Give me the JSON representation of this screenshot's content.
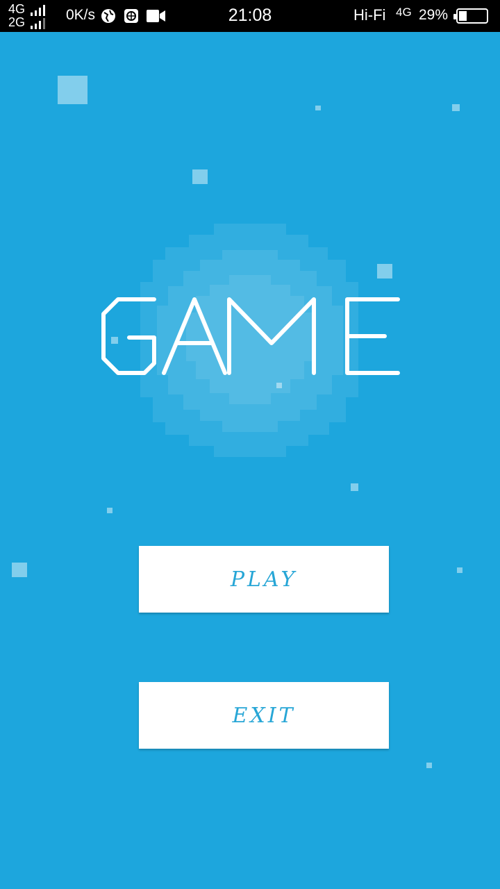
{
  "status_bar": {
    "network_top": "4G",
    "network_bottom": "2G",
    "speed": "0K/s",
    "time": "21:08",
    "hifi": "Hi-Fi",
    "data_type": "4G",
    "battery": "29%",
    "battery_level": 0.29
  },
  "game": {
    "title": "GAME",
    "play_label": "PLAY",
    "exit_label": "EXIT"
  },
  "colors": {
    "background": "#1da6dd",
    "button_text": "#27a6d6",
    "button_bg": "#ffffff"
  }
}
